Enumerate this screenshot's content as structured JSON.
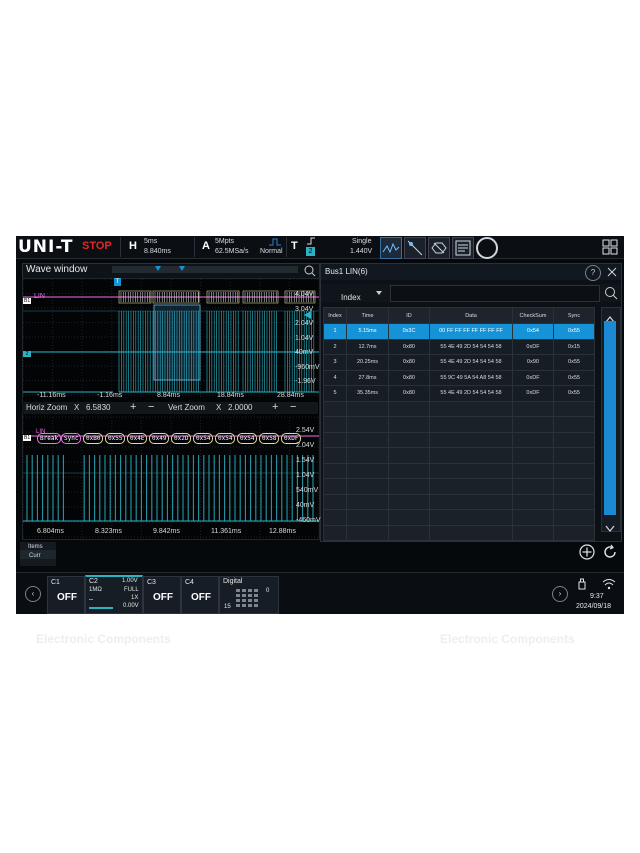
{
  "watermark": {
    "text": "Electronic Components"
  },
  "topbar": {
    "logo": "UNI-T",
    "run_state": "STOP",
    "horizontal": {
      "key": "H",
      "timebase": "5ms",
      "position": "8.840ms"
    },
    "acquire": {
      "key": "A",
      "memory": "5Mpts",
      "sample_rate": "62.5MSa/s",
      "mode": "Normal"
    },
    "trigger": {
      "key": "T",
      "source_badge": "2",
      "mode": "Single",
      "level": "1.440V"
    },
    "colors": {
      "stop": "#e32626",
      "accent": "#1593d6",
      "ch2": "#2ab3c4"
    }
  },
  "wave_window": {
    "title": "Wave window",
    "upper_labels": {
      "bus": "LIN",
      "bus_badge": "B1",
      "ch_badge": "2"
    },
    "upper_volt": [
      "4.04V",
      "3.04V",
      "2.04V",
      "1.04V",
      "40mV",
      "-960mV",
      "-1.96V"
    ],
    "upper_time": [
      "-11.16ms",
      "-1.16ms",
      "8.84ms",
      "18.84ms",
      "28.84ms"
    ],
    "zoom": {
      "horiz_label": "Horiz Zoom",
      "x1": "X",
      "horiz_value": "6.5830",
      "plus": "+",
      "minus": "−",
      "vert_label": "Vert Zoom",
      "x2": "X",
      "vert_value": "2.0000"
    },
    "lower_labels": {
      "bus": "LIN",
      "bus_badge": "B1"
    },
    "decode_frames": [
      "Break",
      "Sync",
      "0xB0",
      "0x55",
      "0x4E",
      "0x49",
      "0x2D",
      "0x54",
      "0x54",
      "0x54",
      "0x58",
      "0xDF"
    ],
    "lower_volt": [
      "2.54V",
      "2.04V",
      "1.54V",
      "1.04V",
      "540mV",
      "40mV",
      "-460mV"
    ],
    "lower_time": [
      "6.804ms",
      "8.323ms",
      "9.842ms",
      "11.361ms",
      "12.88ms"
    ]
  },
  "bus_panel": {
    "title": "Bus1 LIN(6)",
    "index_label": "Index",
    "columns": [
      "Index",
      "Time",
      "ID",
      "Data",
      "CheckSum",
      "Sync"
    ],
    "rows": [
      [
        "1",
        "5.15ms",
        "0x3C",
        "00 FF FF FF FF FF FF FF",
        "0x54",
        "0x55"
      ],
      [
        "2",
        "12.7ms",
        "0x80",
        "55 4E 49 2D 54 54 54 58",
        "0xDF",
        "0x15"
      ],
      [
        "3",
        "20.25ms",
        "0x80",
        "55 4E 49 2D 54 54 54 58",
        "0x90",
        "0x55"
      ],
      [
        "4",
        "27.8ms",
        "0x80",
        "55 9C 49 5A 54 A8 54 58",
        "0xDF",
        "0x55"
      ],
      [
        "5",
        "35.35ms",
        "0x80",
        "55 4E 49 2D 54 54 54 58",
        "0xDF",
        "0x55"
      ]
    ],
    "empty_rows": 9
  },
  "items_button": {
    "line1": "Items",
    "line2": "Curr"
  },
  "channels": {
    "c1": {
      "name": "C1",
      "state": "OFF"
    },
    "c2": {
      "name": "C2",
      "scale": "1.00V",
      "coupling": "1MΩ",
      "bw": "FULL",
      "probe": "1X",
      "offset": "0.00V"
    },
    "c3": {
      "name": "C3",
      "state": "OFF"
    },
    "c4": {
      "name": "C4",
      "state": "OFF"
    },
    "digital": {
      "name": "Digital",
      "low": "0",
      "high": "15"
    }
  },
  "status": {
    "time": "9:37",
    "date": "2024/09/18"
  }
}
